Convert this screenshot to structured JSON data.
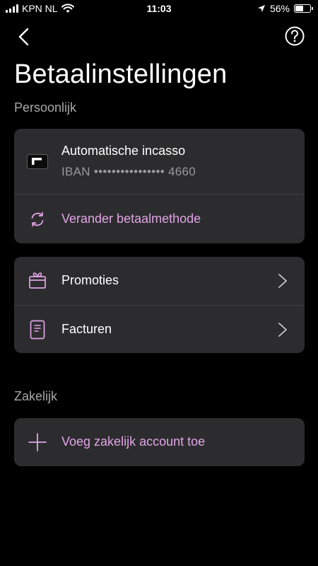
{
  "status_bar": {
    "carrier": "KPN NL",
    "time": "11:03",
    "battery_percent_label": "56%",
    "battery_level": 0.56
  },
  "nav": {
    "back_icon": "chevron-left-icon",
    "help_icon": "question-circle-icon"
  },
  "page": {
    "title": "Betaalinstellingen"
  },
  "personal": {
    "section_label": "Persoonlijk",
    "payment_method": {
      "title": "Automatische incasso",
      "iban_prefix": "IBAN",
      "iban_masked": "••••••••••••••••",
      "iban_suffix": "4660",
      "icon": "bank-card-icon"
    },
    "change_method": {
      "label": "Verander betaalmethode",
      "icon": "refresh-icon"
    },
    "items": [
      {
        "label": "Promoties",
        "icon": "gift-icon"
      },
      {
        "label": "Facturen",
        "icon": "invoice-icon"
      }
    ]
  },
  "business": {
    "section_label": "Zakelijk",
    "add_account": {
      "label": "Voeg zakelijk account toe",
      "icon": "plus-icon"
    }
  },
  "colors": {
    "background": "#000000",
    "card": "#2c2c2e",
    "accent": "#e1a4e6",
    "secondary_text": "#a8a8a8"
  }
}
